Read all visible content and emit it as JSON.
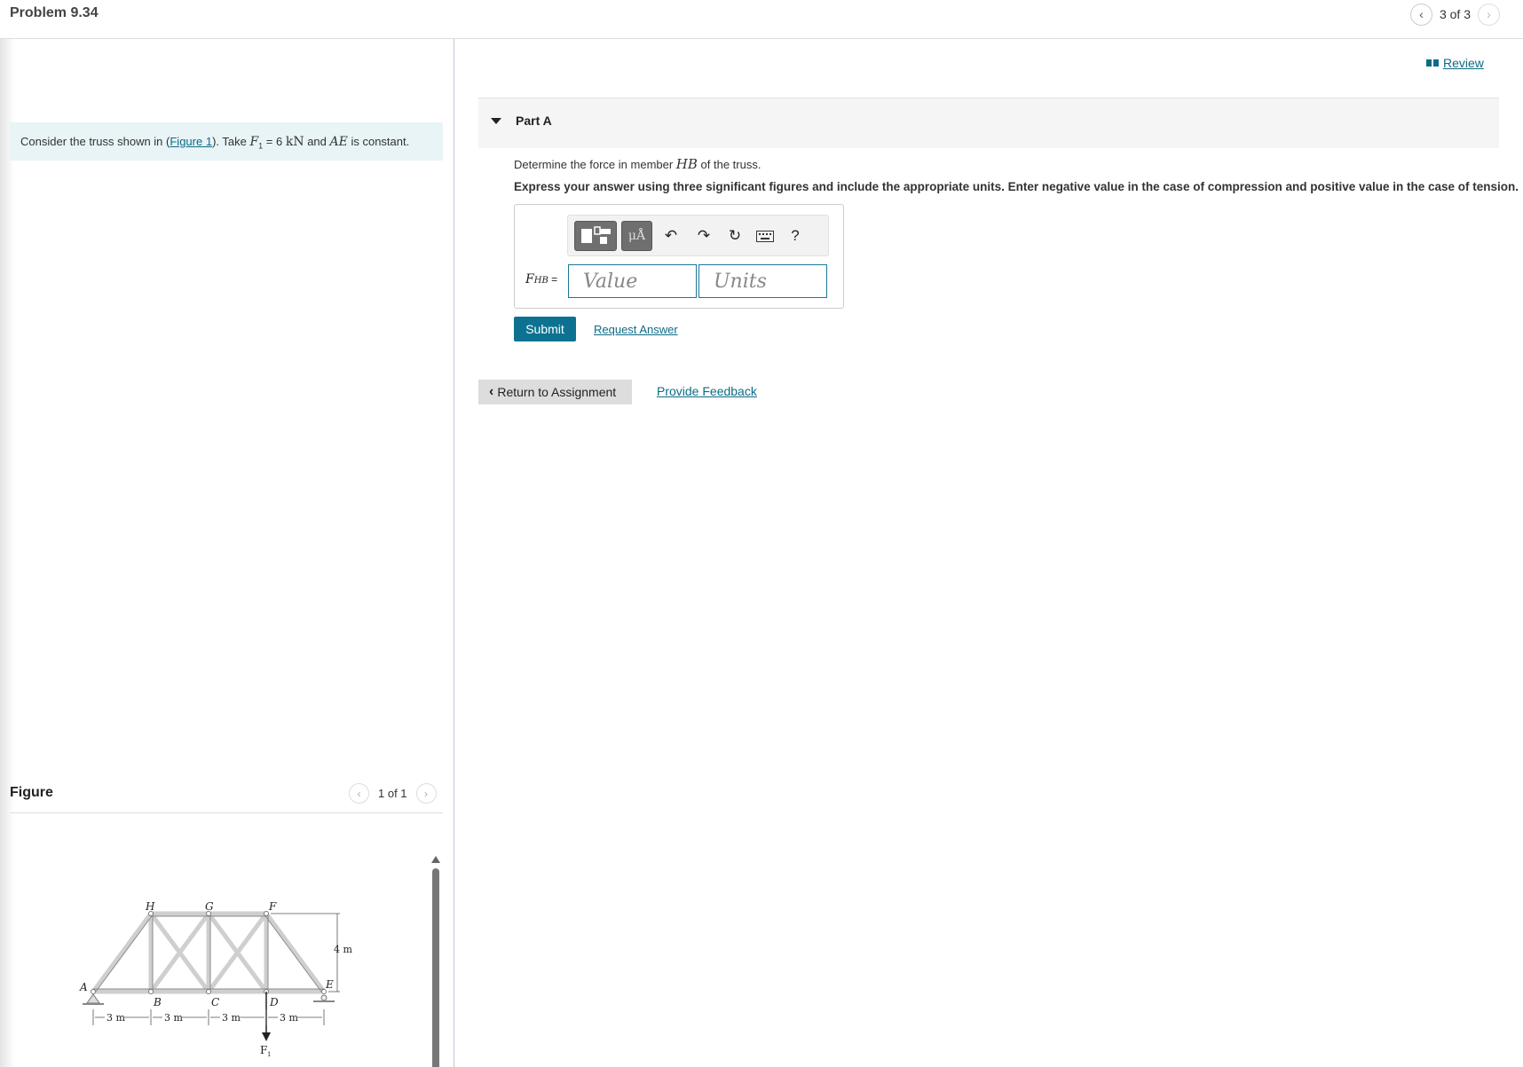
{
  "header": {
    "title": "Problem 9.34",
    "pager_text": "3 of 3",
    "prev_icon": "chevron-left-icon",
    "next_icon": "chevron-right-icon"
  },
  "intro": {
    "text_before": "Consider the truss shown in (",
    "figure_link": "Figure 1",
    "text_mid": "). Take ",
    "f1_symbol": "F",
    "f1_sub": "1",
    "f1_eq": " = 6 ",
    "f1_unit": "kN",
    "text_and": " and ",
    "ae": "AE",
    "text_after": " is constant."
  },
  "figure_panel": {
    "title": "Figure",
    "pager_text": "1 of 1",
    "labels": {
      "A": "A",
      "B": "B",
      "C": "C",
      "D": "D",
      "E": "E",
      "F": "F",
      "G": "G",
      "H": "H",
      "height": "4 m",
      "span": "3 m",
      "load": "F",
      "load_sub": "1"
    }
  },
  "right": {
    "review_label": "Review",
    "part_title": "Part A",
    "question_before": "Determine the force in member ",
    "question_member": "HB",
    "question_after": " of the truss.",
    "instruction": "Express your answer using three significant figures and include the appropriate units. Enter negative value in the case of compression and positive value in the case of tension.",
    "toolbar": {
      "units_symbol": "μÅ",
      "help": "?"
    },
    "answer_label": "F",
    "answer_sub": "HB",
    "answer_eq": " =",
    "value_placeholder": "Value",
    "units_placeholder": "Units",
    "submit_label": "Submit",
    "request_label": "Request Answer",
    "return_label": "Return to Assignment",
    "feedback_label": "Provide Feedback"
  }
}
